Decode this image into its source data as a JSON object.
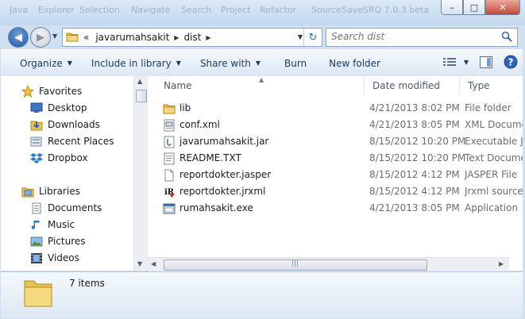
{
  "title_ghost_text": [
    "Java",
    "Explorer",
    "Selection",
    "Navigate",
    "Search",
    "Project",
    "Refactor",
    "Source"
  ],
  "title_ghost_right": "SaveSRQ 7.0.3 beta",
  "window_controls": {
    "minimize": "–",
    "maximize": "□",
    "close": "✕"
  },
  "address": {
    "overflow": "«",
    "crumbs": [
      "javarumahsakit",
      "dist"
    ]
  },
  "search": {
    "placeholder": "Search dist"
  },
  "toolbar": {
    "organize": "Organize",
    "include_in_library": "Include in library",
    "share_with": "Share with",
    "burn": "Burn",
    "new_folder": "New folder"
  },
  "nav_pane": {
    "favorites": {
      "label": "Favorites",
      "items": [
        "Desktop",
        "Downloads",
        "Recent Places",
        "Dropbox"
      ]
    },
    "libraries": {
      "label": "Libraries",
      "items": [
        "Documents",
        "Music",
        "Pictures",
        "Videos"
      ]
    }
  },
  "columns": {
    "name": "Name",
    "date": "Date modified",
    "type": "Type"
  },
  "files": [
    {
      "name": "lib",
      "date": "4/21/2013 8:02 PM",
      "type": "File folder",
      "icon": "folder-icon"
    },
    {
      "name": "conf.xml",
      "date": "4/21/2013 8:05 PM",
      "type": "XML Docume",
      "icon": "xml-file-icon"
    },
    {
      "name": "javarumahsakit.jar",
      "date": "8/15/2012 10:20 PM",
      "type": "Executable Ja",
      "icon": "jar-file-icon"
    },
    {
      "name": "README.TXT",
      "date": "8/15/2012 10:20 PM",
      "type": "Text Docume",
      "icon": "text-file-icon"
    },
    {
      "name": "reportdokter.jasper",
      "date": "8/15/2012 4:12 PM",
      "type": "JASPER File",
      "icon": "blank-file-icon"
    },
    {
      "name": "reportdokter.jrxml",
      "date": "8/15/2012 4:12 PM",
      "type": "Jrxml source",
      "icon": "jrxml-file-icon"
    },
    {
      "name": "rumahsakit.exe",
      "date": "4/21/2013 8:05 PM",
      "type": "Application",
      "icon": "exe-file-icon"
    }
  ],
  "details": {
    "count": "7 items"
  },
  "colors": {
    "toolbar_text": "#1e395b",
    "accent": "#3f7cc4",
    "folder": "#e8c14f"
  }
}
